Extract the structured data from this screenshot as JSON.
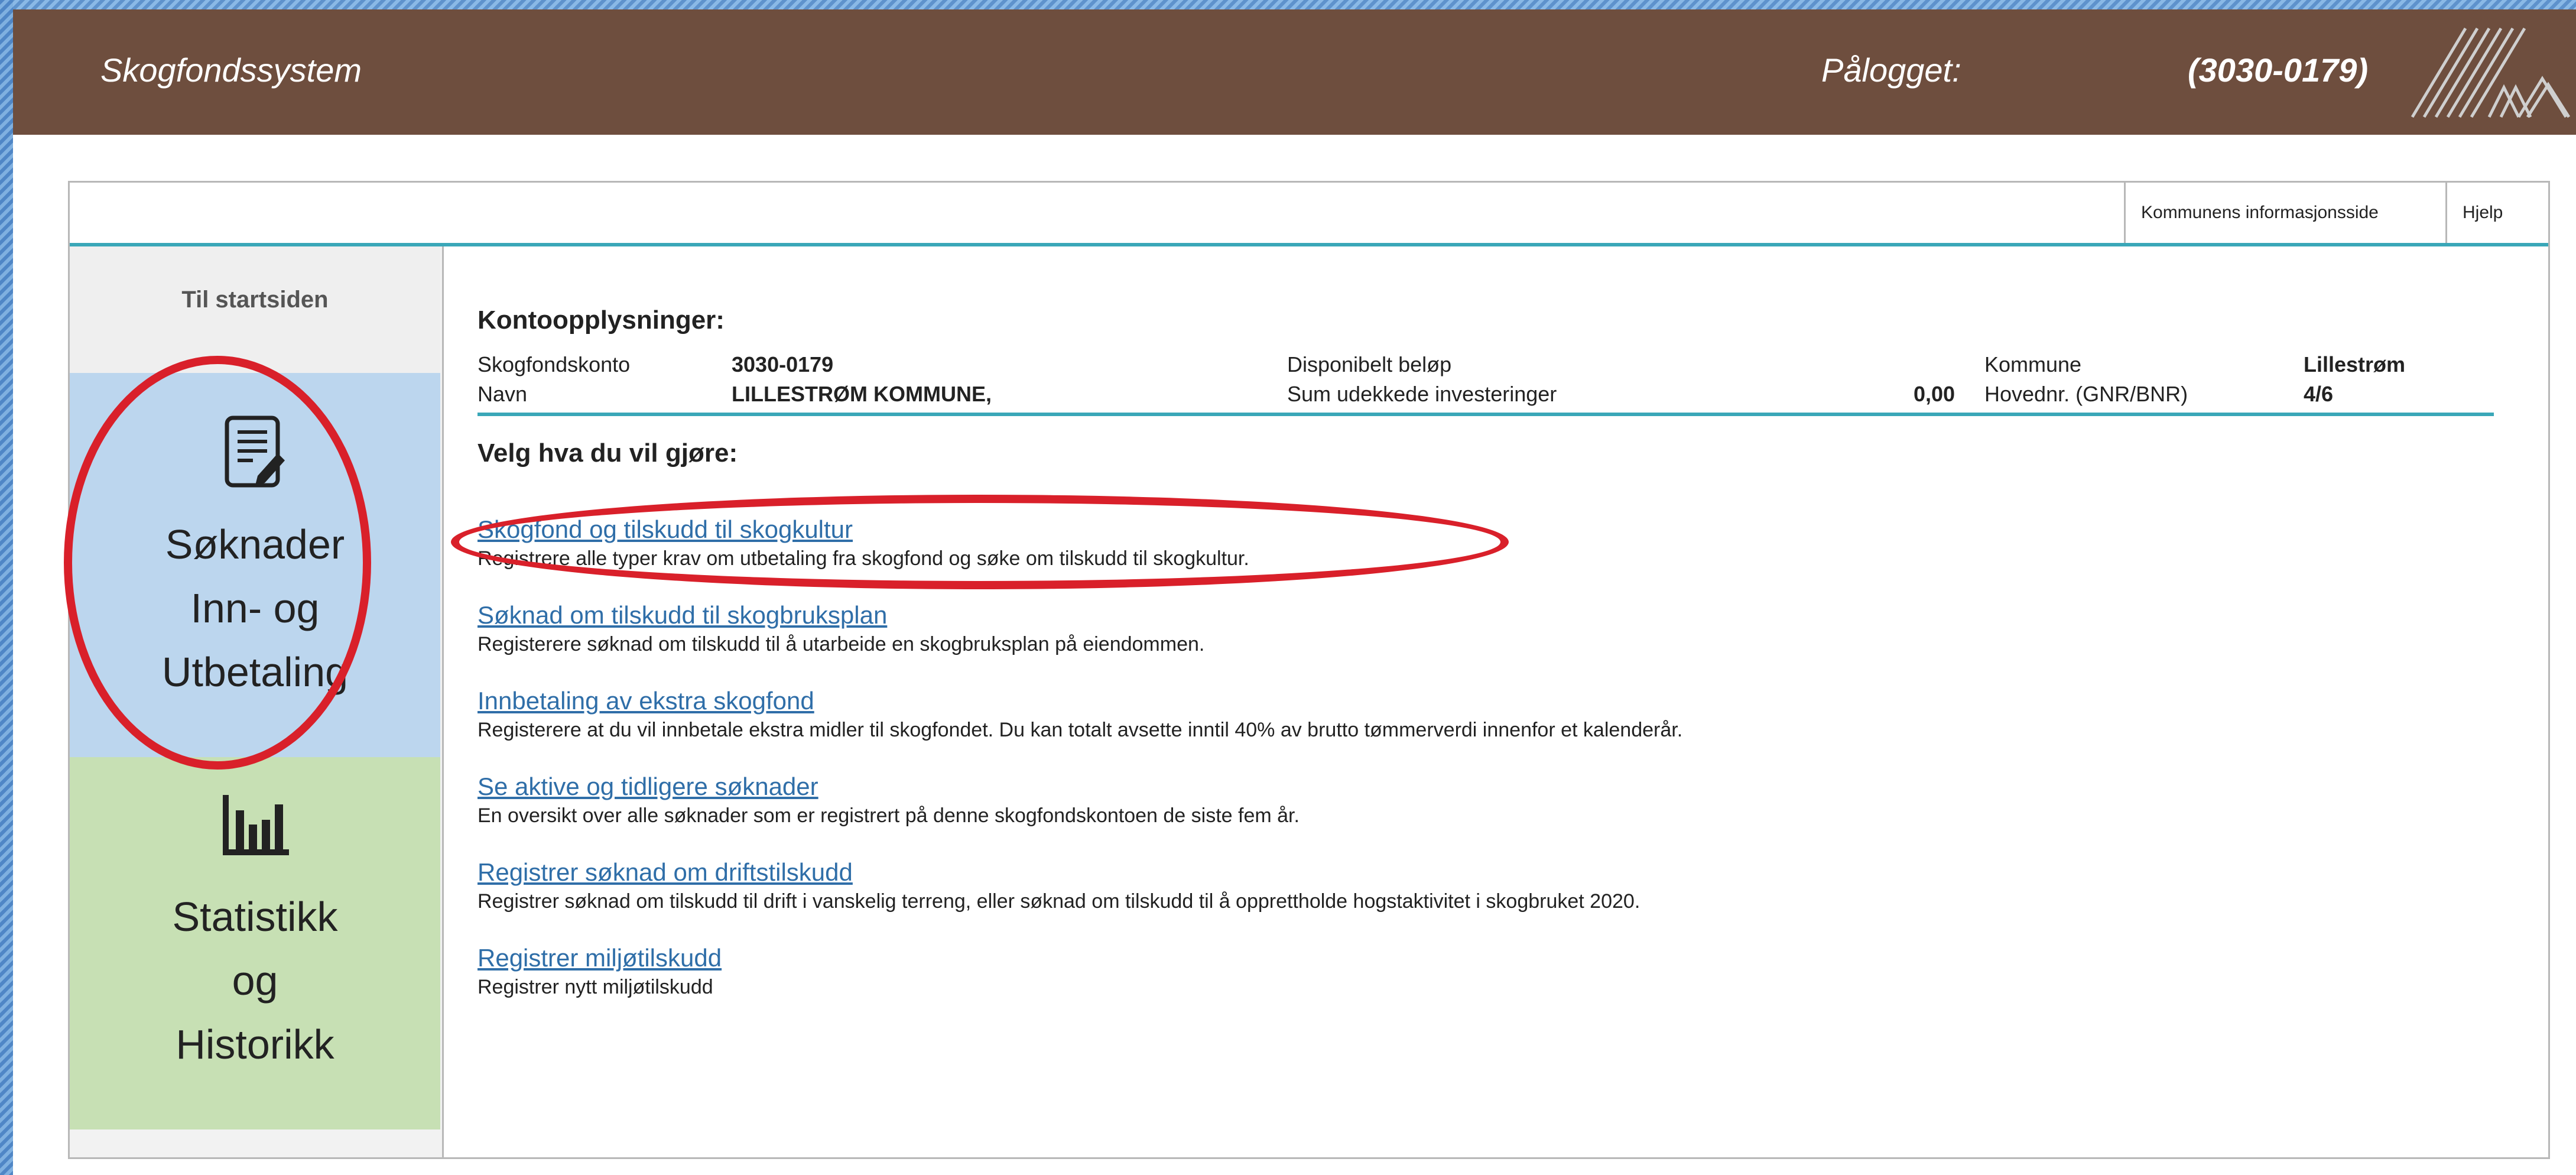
{
  "header": {
    "title": "Skogfondssystem",
    "logged_in_label": "Pålogget:",
    "account": "(3030-0179)"
  },
  "topnav": {
    "info_link": "Kommunens informasjonsside",
    "help_link": "Hjelp"
  },
  "sidebar": {
    "home": "Til startsiden",
    "soknad": {
      "line1": "Søknader",
      "line2": "Inn- og",
      "line3": "Utbetaling",
      "icon": "form-edit-icon"
    },
    "stat": {
      "line1": "Statistikk",
      "line2": "og",
      "line3": "Historikk",
      "icon": "bar-chart-icon"
    }
  },
  "account_info": {
    "heading": "Kontoopplysninger:",
    "rows": [
      {
        "label1": "Skogfondskonto",
        "value1": "3030-0179",
        "label2": "Disponibelt beløp",
        "value2": "",
        "label3": "Kommune",
        "value3": "Lillestrøm"
      },
      {
        "label1": "Navn",
        "value1": "LILLESTRØM KOMMUNE,",
        "label2": "Sum udekkede investeringer",
        "value2": "0,00",
        "label3": "Hovednr. (GNR/BNR)",
        "value3": "4/6"
      }
    ]
  },
  "actions": {
    "heading": "Velg hva du vil gjøre:",
    "items": [
      {
        "link": "Skogfond og tilskudd til skogkultur",
        "desc": "Registrere alle typer krav om utbetaling fra skogfond og søke om tilskudd til skogkultur."
      },
      {
        "link": "Søknad om tilskudd til skogbruksplan",
        "desc": "Registerere søknad om tilskudd til å utarbeide en skogbruksplan på eiendommen."
      },
      {
        "link": "Innbetaling av ekstra skogfond",
        "desc": "Registerere at du vil innbetale ekstra midler til skogfondet. Du kan totalt avsette inntil 40% av brutto tømmerverdi innenfor et kalenderår."
      },
      {
        "link": "Se aktive og tidligere søknader",
        "desc": "En oversikt over alle søknader som er registrert på denne skogfondskontoen de siste fem år."
      },
      {
        "link": "Registrer søknad om driftstilskudd",
        "desc": "Registrer søknad om tilskudd til drift i vanskelig terreng, eller søknad om tilskudd til å opprettholde hogstaktivitet i skogbruket 2020."
      },
      {
        "link": "Registrer miljøtilskudd",
        "desc": "Registrer nytt miljøtilskudd"
      }
    ]
  },
  "colors": {
    "header_bg": "#6e4e3e",
    "accent_line": "#3aa7b8",
    "link": "#2f6ea8",
    "annotation_red": "#d9202a",
    "soknad_bg": "#bcd6ee",
    "stat_bg": "#c7e0b4"
  }
}
